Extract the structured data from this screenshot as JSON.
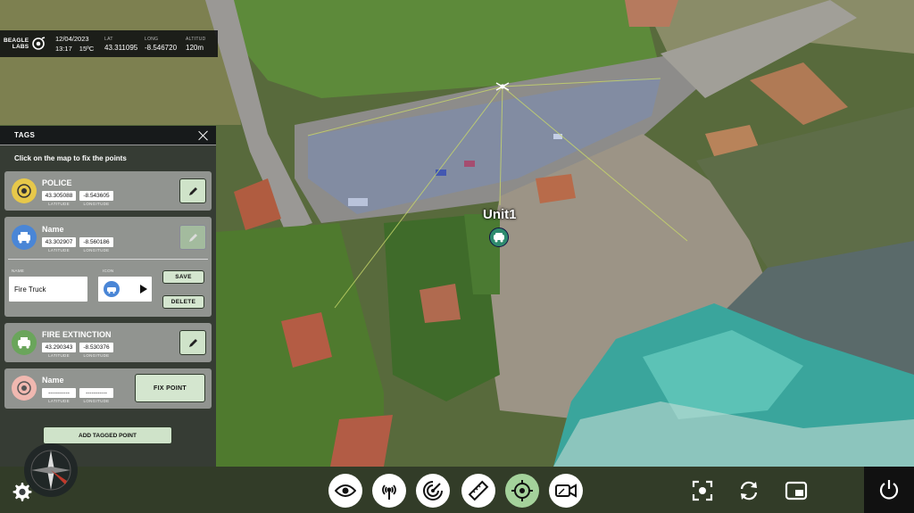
{
  "infobar": {
    "brand_line1": "BEAGLE",
    "brand_line2": "LABS",
    "date": "12/04/2023",
    "time": "13:17",
    "temp": "15ºC",
    "lat_label": "LAT",
    "lat": "43.311095",
    "long_label": "LONG",
    "long": "-8.546720",
    "alt_label": "ALTITUD",
    "alt": "120m"
  },
  "tags": {
    "title": "TAGS",
    "instructions": "Click on the map to fix the points",
    "latitude_label": "LATITUDE",
    "longitude_label": "LONGITUDE",
    "items": [
      {
        "name": "POLICE",
        "lat": "43.305088",
        "lon": "-8.543605",
        "icon": "police-target-icon",
        "color": "#e7c84a"
      },
      {
        "name": "Name",
        "lat": "43.302907",
        "lon": "-8.560186",
        "icon": "fire-truck-icon",
        "color": "#4a86d6"
      },
      {
        "name": "FIRE EXTINCTION",
        "lat": "43.290343",
        "lon": "-8.530376",
        "icon": "fire-extinction-icon",
        "color": "#6aa55b"
      },
      {
        "name": "Name",
        "lat": "-----------",
        "lon": "-----------",
        "icon": "target-icon",
        "color": "#f0b8b0"
      }
    ],
    "editor": {
      "name_label": "NAME",
      "name_value": "Fire Truck",
      "icon_label": "ICON",
      "save_label": "SAVE",
      "delete_label": "DELETE"
    },
    "fix_point_label": "FIX POINT",
    "add_label": "ADD TAGGED POINT"
  },
  "map": {
    "unit_label": "Unit1"
  },
  "toolbar": {
    "tools": [
      "eye-icon",
      "broadcast-icon",
      "radar-icon",
      "ruler-icon",
      "crosshair-icon",
      "video-camera-icon"
    ],
    "active_tool": "crosshair-icon",
    "right_tools": [
      "focus-icon",
      "refresh-icon",
      "picture-in-picture-icon"
    ]
  },
  "colors": {
    "accent": "#a4d29b",
    "panel": "#2d3032"
  }
}
